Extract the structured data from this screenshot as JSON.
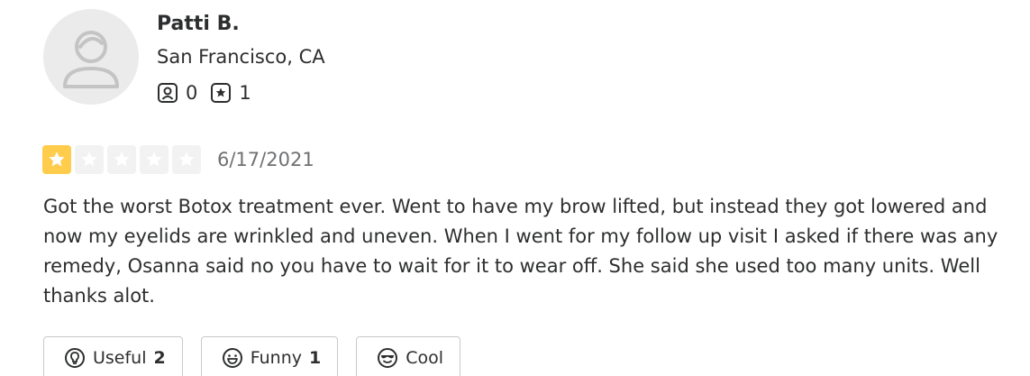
{
  "user": {
    "name": "Patti B.",
    "location": "San Francisco, CA",
    "friends_count": "0",
    "reviews_count": "1"
  },
  "review": {
    "rating": 1,
    "max_rating": 5,
    "date": "6/17/2021",
    "text": "Got the worst Botox treatment ever. Went to have my brow lifted, but instead they got lowered and now my eyelids are wrinkled and uneven. When I went for my follow up visit I asked if there was any remedy, Osanna said no you have to wait for it to wear off. She said she used too many units. Well thanks alot."
  },
  "reactions": {
    "useful_label": "Useful",
    "useful_count": "2",
    "funny_label": "Funny",
    "funny_count": "1",
    "cool_label": "Cool"
  },
  "icons": {
    "avatar": "default-user-avatar-icon",
    "friends": "friends-icon",
    "reviews": "review-star-icon",
    "star": "star-icon",
    "useful": "lightbulb-icon",
    "funny": "smile-face-icon",
    "cool": "sunglasses-face-icon"
  },
  "colors": {
    "star_filled": "#ffcc4b",
    "star_empty": "#f2f2f2",
    "text": "#2d2e2f",
    "muted_text": "#6e7072",
    "border": "#c8c9ca",
    "avatar_bg": "#ebebeb"
  }
}
